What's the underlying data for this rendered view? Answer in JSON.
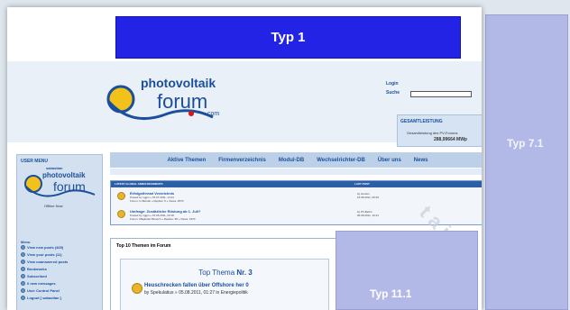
{
  "banners": {
    "top": "Typ 1",
    "right": "Typ 7.1",
    "bottom": "Typ 11.1"
  },
  "watermark": "taii",
  "logo": {
    "line1": "photovoltaik",
    "line2": "forum",
    "line3": ".com"
  },
  "login": {
    "login_label": "Login",
    "search_label": "Suche"
  },
  "total": {
    "title": "GESAMTLEISTUNG",
    "subtitle": "Gesamtleistung des PV-Forums",
    "value": "288,99664 MWp"
  },
  "sidebar": {
    "title": "USER MENU",
    "username": "sabastian",
    "status": "Offline Now",
    "menu_title": "Menu",
    "items": [
      "View new posts (465)",
      "View your posts (11)",
      "View unanswered posts",
      "Bookmarks",
      "Subscribed",
      "0 new messages",
      "User Control Panel",
      "Logout [ sabastian ]"
    ]
  },
  "nav": {
    "items": [
      "Aktive Themen",
      "Firmenverzeichnis",
      "Modul-DB",
      "Wechselrichter-DB",
      "Über uns",
      "News"
    ]
  },
  "announcements": {
    "header": "LATEST GLOBAL ANNOUNCEMENTS",
    "last_post_header": "LAST POST",
    "rows": [
      {
        "title": "Erfolgsthread Verzeichnis",
        "meta1": "Posted by nggin » 15.07.2011, 14:24",
        "meta2": "Forum: In Betrieb » Replies: 5 » Views: 2570",
        "last1": "by Gunton",
        "last2": "15.08.2011, 00:29"
      },
      {
        "title": "Umfrage: Zusätzliche Rüstung ab 1. Juli?",
        "meta1": "Posted by nggin » 15.06.2011, 20:18",
        "meta2": "Forum: Mitglieder-Bereich » Replies: 38 » Views: 1970",
        "last1": "by PV-Berlin",
        "last2": "06.08.2011, 10:21"
      }
    ]
  },
  "top10": {
    "title": "Top 10 Themen im Forum",
    "label_prefix": "Top Thema",
    "label_number": "Nr. 3",
    "post_title": "Heuschrecken fallen über Offshore her 0",
    "post_meta": "by Spekulatius » 05.08.2011, 01:27 in Energiepolitik"
  }
}
